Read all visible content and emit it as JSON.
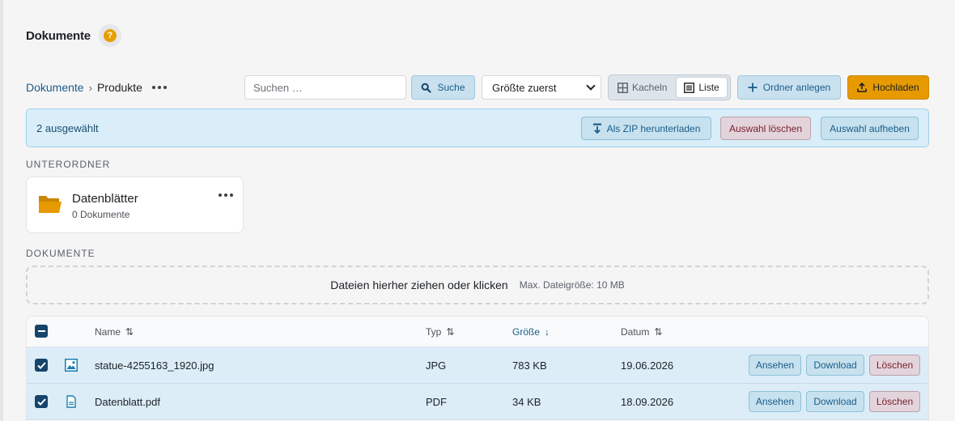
{
  "page": {
    "title": "Dokumente",
    "help_icon": "question-circle-icon"
  },
  "breadcrumb": {
    "root": "Dokumente",
    "separator": "›",
    "current": "Produkte"
  },
  "toolbar": {
    "search_placeholder": "Suchen …",
    "search_value": "",
    "search_button": "Suche",
    "sort_selected": "Größte zuerst",
    "view_tiles": "Kacheln",
    "view_list": "Liste",
    "view_active": "list",
    "new_folder": "Ordner anlegen",
    "upload": "Hochladen"
  },
  "selection": {
    "count_text": "2 ausgewählt",
    "zip": "Als ZIP herunterladen",
    "delete_selection": "Auswahl löschen",
    "clear_selection": "Auswahl aufheben"
  },
  "subfolders": {
    "label": "UNTERORDNER",
    "items": [
      {
        "name": "Datenblätter",
        "count": "0 Dokumente"
      }
    ]
  },
  "documents": {
    "label": "DOKUMENTE",
    "dropzone_text": "Dateien hierher ziehen oder klicken",
    "dropzone_hint": "Max. Dateigröße: 10 MB",
    "columns": {
      "name": "Name",
      "type": "Typ",
      "size": "Größe",
      "date": "Datum"
    },
    "sort_indicator": "⇅",
    "sort_active": "↓",
    "rows": [
      {
        "name": "statue-4255163_1920.jpg",
        "type": "JPG",
        "size": "783 KB",
        "date": "19.06.2026",
        "icon": "image-file-icon",
        "selected": true
      },
      {
        "name": "Datenblatt.pdf",
        "type": "PDF",
        "size": "34 KB",
        "date": "18.09.2026",
        "icon": "document-file-icon",
        "selected": true
      }
    ],
    "actions": {
      "view": "Ansehen",
      "download": "Download",
      "delete": "Löschen"
    }
  },
  "colors": {
    "accent": "#1a5d8a",
    "upload": "#e69a00",
    "danger": "#7a1f2e",
    "selection_bg": "#d9eef9"
  }
}
